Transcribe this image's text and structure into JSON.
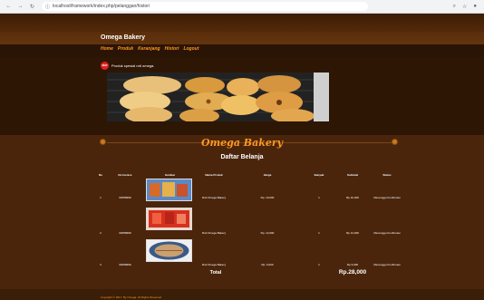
{
  "browser": {
    "url": "localhost/framework/index.php/pelanggan/histori"
  },
  "site": {
    "brand": "Omega Bakery",
    "menu": [
      "Home",
      "Produk",
      "Keranjang",
      "Histori",
      "Logout"
    ],
    "promo_badge": "NEW",
    "promo_text": "Produk spesial roti omega.",
    "section_title": "Omega Bakery",
    "page_title": "Daftar Belanja"
  },
  "table": {
    "headers": [
      "No",
      "No Invoice",
      "Gambar",
      "Nama Produk",
      "Harga",
      "Banyak",
      "Subtotal",
      "Status"
    ],
    "rows": [
      {
        "no": "1",
        "invoice": "00058999",
        "product": "Roti Omega Bakery",
        "price": "Rp. 10,000",
        "qty": "1",
        "subtotal": "Rp 10,000",
        "status": "Menunggu Konfirmasi"
      },
      {
        "no": "2",
        "invoice": "00058999",
        "product": "Roti Omega Bakery",
        "price": "Rp. 12,000",
        "qty": "1",
        "subtotal": "Rp 12,000",
        "status": "Menunggu Konfirmasi"
      },
      {
        "no": "3",
        "invoice": "00058999",
        "product": "Roti Omega Bakery",
        "price": "Rp. 6,000",
        "qty": "1",
        "subtotal": "Rp 6,000",
        "status": "Menunggu Konfirmasi"
      }
    ],
    "total_label": "Total",
    "total_value": "Rp.28,000"
  },
  "footer": {
    "copyright": "Copyright © 2017. By Omega. All Rights Reserved"
  },
  "colors": {
    "accent": "#ff9a1f",
    "background": "#4a250c"
  }
}
